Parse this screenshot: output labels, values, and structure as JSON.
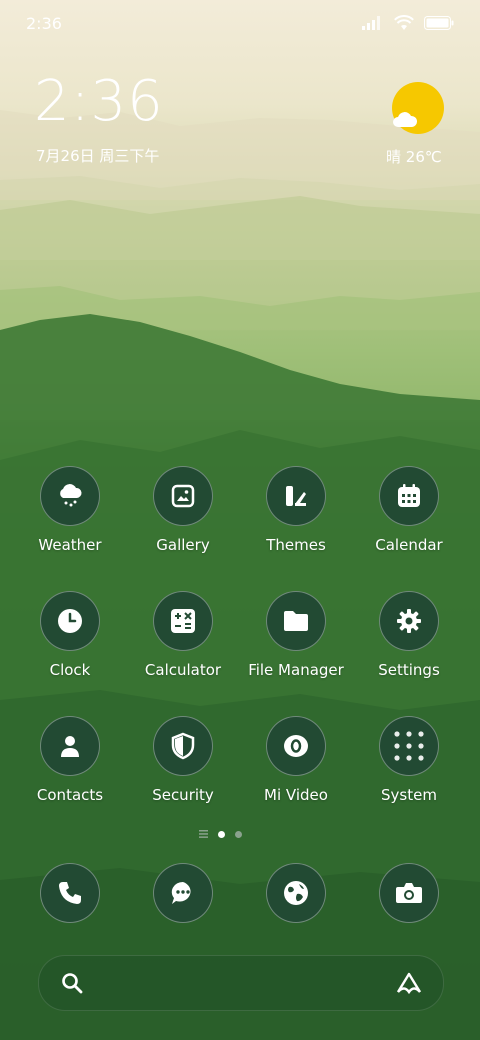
{
  "colors": {
    "icon_bg": "#224a33",
    "sun": "#f6c800",
    "text": "#ffffff",
    "pager_active": "#ffffff",
    "pager_inactive": "#8aa28e"
  },
  "status_bar": {
    "time": "2:36",
    "icons": [
      "signal-icon",
      "wifi-icon",
      "battery-icon"
    ]
  },
  "clock_widget": {
    "time": "2:36",
    "date": "7月26日 周三下午"
  },
  "weather_widget": {
    "condition": "晴",
    "temperature": "26℃",
    "icons": [
      "sun-icon",
      "cloud-icon"
    ]
  },
  "apps": [
    {
      "label": "Weather",
      "icon": "weather-icon"
    },
    {
      "label": "Gallery",
      "icon": "gallery-icon"
    },
    {
      "label": "Themes",
      "icon": "themes-icon"
    },
    {
      "label": "Calendar",
      "icon": "calendar-icon"
    },
    {
      "label": "Clock",
      "icon": "clock-icon"
    },
    {
      "label": "Calculator",
      "icon": "calculator-icon"
    },
    {
      "label": "File Manager",
      "icon": "folder-icon"
    },
    {
      "label": "Settings",
      "icon": "gear-icon"
    },
    {
      "label": "Contacts",
      "icon": "contacts-icon"
    },
    {
      "label": "Security",
      "icon": "shield-icon"
    },
    {
      "label": "Mi Video",
      "icon": "video-icon"
    },
    {
      "label": "System",
      "icon": "folder-grid-icon"
    }
  ],
  "pager": {
    "pages": [
      "list",
      "home",
      "page-2"
    ],
    "active": "home"
  },
  "dock": [
    {
      "icon": "phone-icon"
    },
    {
      "icon": "messages-icon"
    },
    {
      "icon": "browser-icon"
    },
    {
      "icon": "camera-icon"
    }
  ],
  "search_bar": {
    "icons": [
      "search-icon",
      "assistant-icon"
    ]
  }
}
